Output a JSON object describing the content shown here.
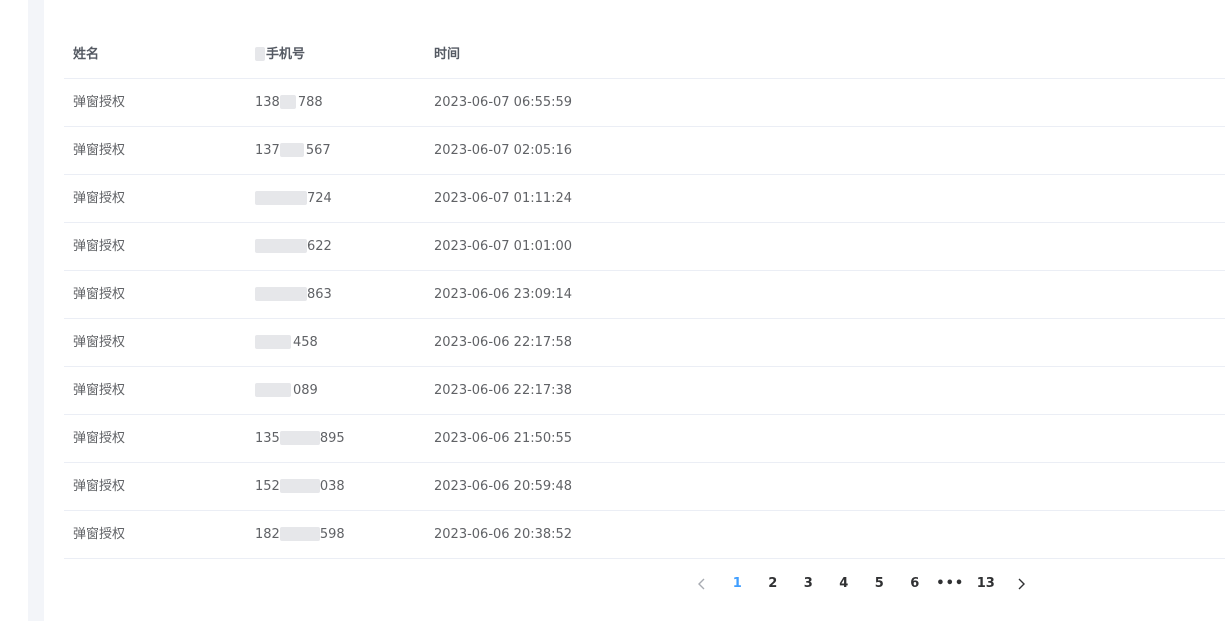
{
  "table": {
    "headers": {
      "name": "姓名",
      "phone": "手机号",
      "time": "时间"
    },
    "rows": [
      {
        "name": "弹窗授权",
        "phone_prefix": "138",
        "phone_suffix": "788",
        "time": "2023-06-07 06:55:59"
      },
      {
        "name": "弹窗授权",
        "phone_prefix": "137",
        "phone_suffix": "567",
        "time": "2023-06-07 02:05:16"
      },
      {
        "name": "弹窗授权",
        "phone_prefix": "",
        "phone_suffix": "724",
        "time": "2023-06-07 01:11:24"
      },
      {
        "name": "弹窗授权",
        "phone_prefix": "",
        "phone_suffix": "622",
        "time": "2023-06-07 01:01:00"
      },
      {
        "name": "弹窗授权",
        "phone_prefix": "",
        "phone_suffix": "863",
        "time": "2023-06-06 23:09:14"
      },
      {
        "name": "弹窗授权",
        "phone_prefix": "",
        "phone_suffix": "458",
        "time": "2023-06-06 22:17:58"
      },
      {
        "name": "弹窗授权",
        "phone_prefix": "",
        "phone_suffix": "089",
        "time": "2023-06-06 22:17:38"
      },
      {
        "name": "弹窗授权",
        "phone_prefix": "135",
        "phone_suffix": "895",
        "time": "2023-06-06 21:50:55"
      },
      {
        "name": "弹窗授权",
        "phone_prefix": "152",
        "phone_suffix": "038",
        "time": "2023-06-06 20:59:48"
      },
      {
        "name": "弹窗授权",
        "phone_prefix": "182",
        "phone_suffix": "598",
        "time": "2023-06-06 20:38:52"
      }
    ]
  },
  "pagination": {
    "prev_icon": "chevron-left-icon",
    "next_icon": "chevron-right-icon",
    "pages": [
      "1",
      "2",
      "3",
      "4",
      "5",
      "6",
      "•••",
      "13"
    ],
    "current": "1",
    "colors": {
      "active": "#409eff",
      "default": "#303133",
      "arrow": "#a8abb2"
    }
  }
}
